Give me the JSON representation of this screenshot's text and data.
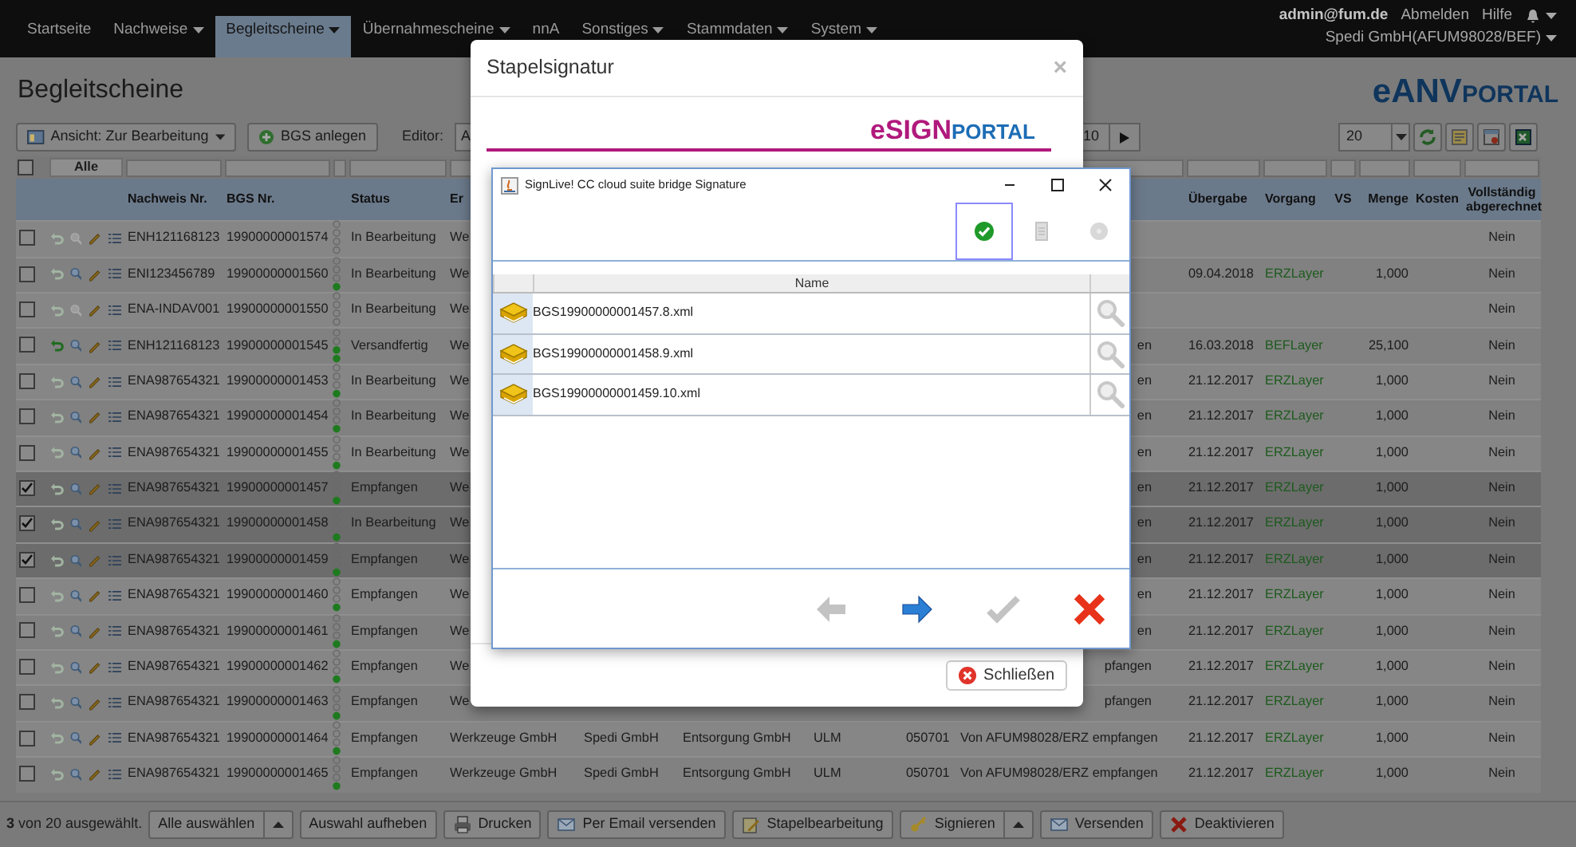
{
  "navbar": {
    "items": [
      {
        "label": "Startseite",
        "dropdown": false,
        "selected": false
      },
      {
        "label": "Nachweise",
        "dropdown": true,
        "selected": false
      },
      {
        "label": "Begleitscheine",
        "dropdown": true,
        "selected": true
      },
      {
        "label": "Übernahmescheine",
        "dropdown": true,
        "selected": false
      },
      {
        "label": "nnA",
        "dropdown": false,
        "selected": false
      },
      {
        "label": "Sonstiges",
        "dropdown": true,
        "selected": false
      },
      {
        "label": "Stammdaten",
        "dropdown": true,
        "selected": false
      },
      {
        "label": "System",
        "dropdown": true,
        "selected": false
      }
    ],
    "user": "admin@fum.de",
    "logout": "Abmelden",
    "help": "Hilfe",
    "company": "Spedi GmbH(AFUM98028/BEF)"
  },
  "page_title": "Begleitscheine",
  "logo": {
    "main": "eANV",
    "suffix": "PORTAL"
  },
  "toolbar": {
    "view_button": "Ansicht: Zur Bearbeitung",
    "create_button": "BGS anlegen",
    "editor_label": "Editor:",
    "editor_value": "A",
    "page": "10",
    "page_size": "20"
  },
  "table": {
    "select_all": {
      "checked": false
    },
    "filter_all": "Alle",
    "columns": [
      "Nachweis Nr.",
      "BGS Nr.",
      "Status",
      "Er",
      "Übergabe",
      "Vorgang",
      "VS",
      "Menge",
      "Kosten",
      "Vollständig abgerechnet"
    ],
    "rows": [
      {
        "checked": false,
        "return_enabled": false,
        "view_enabled": false,
        "nachweis": "ENH121168123",
        "bgs": "19900000001574",
        "dots": [
          false,
          false,
          false,
          false
        ],
        "status": "In Bearbeitung",
        "column_7": "We",
        "abgerechnet": "Nein"
      },
      {
        "checked": false,
        "return_enabled": false,
        "view_enabled": true,
        "nachweis": "ENI123456789",
        "bgs": "19900000001560",
        "dots": [
          false,
          false,
          false,
          true
        ],
        "status": "In Bearbeitung",
        "column_7": "We",
        "uebergabe": "09.04.2018",
        "vorgang": "ERZLayer",
        "menge": "1,000",
        "abgerechnet": "Nein"
      },
      {
        "checked": false,
        "return_enabled": false,
        "view_enabled": false,
        "nachweis": "ENA-INDAV001",
        "bgs": "19900000001550",
        "dots": [
          false,
          false,
          false,
          false
        ],
        "status": "In Bearbeitung",
        "column_7": "We",
        "abgerechnet": "Nein"
      },
      {
        "checked": false,
        "return_enabled": true,
        "view_enabled": true,
        "nachweis": "ENH121168123",
        "bgs": "19900000001545",
        "dots": [
          false,
          false,
          true,
          true
        ],
        "status": "Versandfertig",
        "column_7": "We",
        "column_12": "en",
        "uebergabe": "16.03.2018",
        "vorgang": "BEFLayer",
        "menge": "25,100",
        "abgerechnet": "Nein"
      },
      {
        "checked": false,
        "return_enabled": false,
        "view_enabled": true,
        "nachweis": "ENA987654321",
        "bgs": "19900000001453",
        "dots": [
          false,
          false,
          false,
          true
        ],
        "status": "In Bearbeitung",
        "column_7": "We",
        "column_12": "en",
        "uebergabe": "21.12.2017",
        "vorgang": "ERZLayer",
        "menge": "1,000",
        "abgerechnet": "Nein"
      },
      {
        "checked": false,
        "return_enabled": false,
        "view_enabled": true,
        "nachweis": "ENA987654321",
        "bgs": "19900000001454",
        "dots": [
          false,
          false,
          false,
          true
        ],
        "status": "In Bearbeitung",
        "column_7": "We",
        "column_12": "en",
        "uebergabe": "21.12.2017",
        "vorgang": "ERZLayer",
        "menge": "1,000",
        "abgerechnet": "Nein"
      },
      {
        "checked": false,
        "return_enabled": false,
        "view_enabled": true,
        "nachweis": "ENA987654321",
        "bgs": "19900000001455",
        "dots": [
          false,
          false,
          false,
          true
        ],
        "status": "In Bearbeitung",
        "column_7": "We",
        "column_12": "en",
        "uebergabe": "21.12.2017",
        "vorgang": "ERZLayer",
        "menge": "1,000",
        "abgerechnet": "Nein"
      },
      {
        "checked": true,
        "return_enabled": false,
        "view_enabled": true,
        "nachweis": "ENA987654321",
        "bgs": "19900000001457",
        "dots": [
          false,
          false,
          false,
          true
        ],
        "status": "Empfangen",
        "column_7": "We",
        "column_12": "en",
        "uebergabe": "21.12.2017",
        "vorgang": "ERZLayer",
        "menge": "1,000",
        "abgerechnet": "Nein"
      },
      {
        "checked": true,
        "return_enabled": false,
        "view_enabled": true,
        "nachweis": "ENA987654321",
        "bgs": "19900000001458",
        "dots": [
          false,
          false,
          false,
          true
        ],
        "status": "In Bearbeitung",
        "column_7": "We",
        "column_12": "en",
        "uebergabe": "21.12.2017",
        "vorgang": "ERZLayer",
        "menge": "1,000",
        "abgerechnet": "Nein"
      },
      {
        "checked": true,
        "return_enabled": false,
        "view_enabled": true,
        "nachweis": "ENA987654321",
        "bgs": "19900000001459",
        "dots": [
          false,
          false,
          false,
          true
        ],
        "status": "Empfangen",
        "column_7": "We",
        "column_12": "en",
        "uebergabe": "21.12.2017",
        "vorgang": "ERZLayer",
        "menge": "1,000",
        "abgerechnet": "Nein"
      },
      {
        "checked": false,
        "return_enabled": false,
        "view_enabled": true,
        "nachweis": "ENA987654321",
        "bgs": "19900000001460",
        "dots": [
          false,
          false,
          false,
          true
        ],
        "status": "Empfangen",
        "column_7": "We",
        "column_12": "en",
        "uebergabe": "21.12.2017",
        "vorgang": "ERZLayer",
        "menge": "1,000",
        "abgerechnet": "Nein"
      },
      {
        "checked": false,
        "return_enabled": false,
        "view_enabled": true,
        "nachweis": "ENA987654321",
        "bgs": "19900000001461",
        "dots": [
          false,
          false,
          false,
          true
        ],
        "status": "Empfangen",
        "column_7": "We",
        "column_12": "en",
        "uebergabe": "21.12.2017",
        "vorgang": "ERZLayer",
        "menge": "1,000",
        "abgerechnet": "Nein"
      },
      {
        "checked": false,
        "return_enabled": false,
        "view_enabled": true,
        "nachweis": "ENA987654321",
        "bgs": "19900000001462",
        "dots": [
          false,
          false,
          false,
          true
        ],
        "status": "Empfangen",
        "column_7": "We",
        "column_12": "pfangen",
        "uebergabe": "21.12.2017",
        "vorgang": "ERZLayer",
        "menge": "1,000",
        "abgerechnet": "Nein"
      },
      {
        "checked": false,
        "return_enabled": false,
        "view_enabled": true,
        "nachweis": "ENA987654321",
        "bgs": "19900000001463",
        "dots": [
          false,
          false,
          false,
          true
        ],
        "status": "Empfangen",
        "column_7": "We",
        "column_12": "pfangen",
        "uebergabe": "21.12.2017",
        "vorgang": "ERZLayer",
        "menge": "1,000",
        "abgerechnet": "Nein"
      },
      {
        "checked": false,
        "return_enabled": false,
        "view_enabled": true,
        "nachweis": "ENA987654321",
        "bgs": "19900000001464",
        "dots": [
          false,
          false,
          false,
          true
        ],
        "status": "Empfangen",
        "column_7": "Werkzeuge GmbH",
        "column_8": "Spedi GmbH",
        "column_9": "Entsorgung GmbH",
        "column_10": "ULM",
        "column_11": "050701",
        "column_12": "Von AFUM98028/ERZ empfangen",
        "uebergabe": "21.12.2017",
        "vorgang": "ERZLayer",
        "menge": "1,000",
        "abgerechnet": "Nein"
      },
      {
        "checked": false,
        "return_enabled": false,
        "view_enabled": true,
        "nachweis": "ENA987654321",
        "bgs": "19900000001465",
        "dots": [
          false,
          false,
          false,
          true
        ],
        "status": "Empfangen",
        "column_7": "Werkzeuge GmbH",
        "column_8": "Spedi GmbH",
        "column_9": "Entsorgung GmbH",
        "column_10": "ULM",
        "column_11": "050701",
        "column_12": "Von AFUM98028/ERZ empfangen",
        "uebergabe": "21.12.2017",
        "vorgang": "ERZLayer",
        "menge": "1,000",
        "abgerechnet": "Nein"
      }
    ]
  },
  "selection_bar": {
    "summary": "**3** von 20 ausgewählt.",
    "buttons": [
      {
        "label": "Alle auswählen",
        "kind": "plain",
        "split": true
      },
      {
        "label": "Auswahl aufheben",
        "kind": "plain",
        "split": false
      },
      {
        "label": "Drucken",
        "kind": "print",
        "split": false
      },
      {
        "label": "Per Email versenden",
        "kind": "mail",
        "split": false
      },
      {
        "label": "Stapelbearbeitung",
        "kind": "edit",
        "split": false
      },
      {
        "label": "Signieren",
        "kind": "sign",
        "split": true
      },
      {
        "label": "Versenden",
        "kind": "mail",
        "split": false
      },
      {
        "label": "Deaktivieren",
        "kind": "deactivate",
        "split": false
      }
    ]
  },
  "modal": {
    "title": "Stapelsignatur",
    "close": "×",
    "brand": {
      "main": "eSIGN",
      "suffix": "PORTAL"
    },
    "signer": {
      "title": "SignLive! CC cloud suite bridge Signature",
      "tools": [
        {
          "kind": "check",
          "selected": true
        },
        {
          "kind": "document",
          "selected": false
        },
        {
          "kind": "info",
          "selected": false
        }
      ],
      "column": "Name",
      "files": [
        {
          "name": "BGS19900000001457.8.xml"
        },
        {
          "name": "BGS19900000001458.9.xml"
        },
        {
          "name": "BGS19900000001459.10.xml"
        }
      ],
      "nav": [
        {
          "kind": "back",
          "enabled": false
        },
        {
          "kind": "forward",
          "enabled": true
        },
        {
          "kind": "confirm",
          "enabled": false
        },
        {
          "kind": "cancel",
          "enabled": true
        }
      ]
    },
    "close_button": "Schließen"
  }
}
